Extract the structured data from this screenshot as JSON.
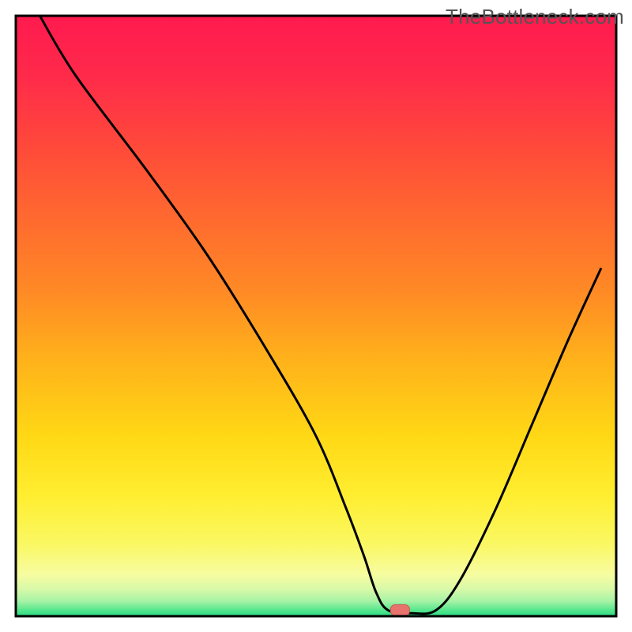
{
  "watermark": "TheBottleneck.com",
  "colors": {
    "gradient_stops": [
      {
        "offset": 0.0,
        "color": "#ff1a4f"
      },
      {
        "offset": 0.1,
        "color": "#ff2a4a"
      },
      {
        "offset": 0.22,
        "color": "#ff4a3a"
      },
      {
        "offset": 0.34,
        "color": "#ff6a2f"
      },
      {
        "offset": 0.46,
        "color": "#ff8a25"
      },
      {
        "offset": 0.58,
        "color": "#ffb41a"
      },
      {
        "offset": 0.7,
        "color": "#ffd815"
      },
      {
        "offset": 0.8,
        "color": "#ffee30"
      },
      {
        "offset": 0.88,
        "color": "#faf863"
      },
      {
        "offset": 0.93,
        "color": "#f7fca0"
      },
      {
        "offset": 0.955,
        "color": "#d8f9a8"
      },
      {
        "offset": 0.975,
        "color": "#a6f3a6"
      },
      {
        "offset": 0.99,
        "color": "#55e68c"
      },
      {
        "offset": 1.0,
        "color": "#29dd85"
      }
    ],
    "curve_stroke": "#000000",
    "marker_fill": "#e8736d",
    "marker_stroke": "#cc5851",
    "frame_stroke": "#000000"
  },
  "chart_data": {
    "type": "line",
    "title": "",
    "xlabel": "",
    "ylabel": "",
    "xlim": [
      0,
      100
    ],
    "ylim": [
      0,
      100
    ],
    "grid": false,
    "legend": false,
    "series": [
      {
        "name": "bottleneck-curve",
        "x": [
          4,
          10,
          22,
          32,
          42,
          50,
          55,
          58,
          60,
          62,
          66,
          70,
          74,
          80,
          86,
          92,
          97.5
        ],
        "y": [
          100,
          90,
          74,
          60,
          44,
          30,
          18,
          10,
          4,
          1,
          0.5,
          1,
          6,
          18,
          32,
          46,
          58
        ]
      }
    ],
    "marker": {
      "x": 64,
      "y": 1
    },
    "annotations": []
  }
}
